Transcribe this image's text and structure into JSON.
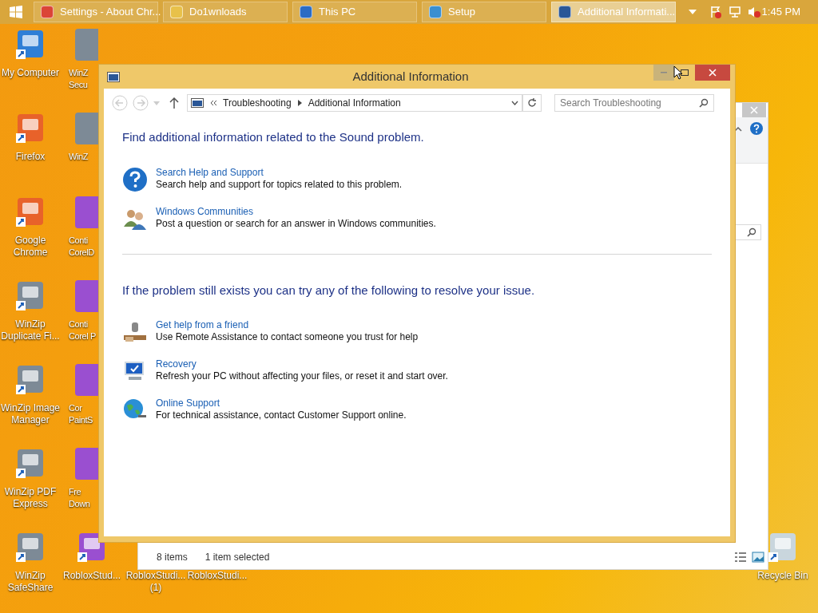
{
  "taskbar": {
    "buttons": [
      {
        "label": "Settings - About Chr...",
        "selected": false,
        "kind": "browser"
      },
      {
        "label": "Do1wnloads",
        "selected": false,
        "kind": "folder"
      },
      {
        "label": "This PC",
        "selected": false,
        "kind": "computer"
      },
      {
        "label": "Setup",
        "selected": false,
        "kind": "installer"
      },
      {
        "label": "Additional Informati...",
        "selected": true,
        "kind": "window"
      }
    ],
    "time": "1:45 PM"
  },
  "desktop": {
    "first_column": [
      {
        "lines": [
          "My Computer"
        ],
        "kind": "computer"
      },
      {
        "lines": [
          "Firefox"
        ],
        "kind": "browser"
      },
      {
        "lines": [
          "Google",
          "Chrome"
        ],
        "kind": "browser"
      },
      {
        "lines": [
          "WinZip",
          "Duplicate Fi..."
        ],
        "kind": "archive"
      },
      {
        "lines": [
          "WinZip Image",
          "Manager"
        ],
        "kind": "archive"
      },
      {
        "lines": [
          "WinZip PDF",
          "Express"
        ],
        "kind": "archive"
      },
      {
        "lines": [
          "WinZip",
          "SafeShare"
        ],
        "kind": "archive"
      }
    ],
    "second_column": [
      {
        "lines": [
          "WinZ",
          "Secu"
        ],
        "kind": "archive"
      },
      {
        "lines": [
          "WinZ"
        ],
        "kind": "archive"
      },
      {
        "lines": [
          "Conti",
          "CorelD"
        ],
        "kind": "app"
      },
      {
        "lines": [
          "Conti",
          "Corel P"
        ],
        "kind": "app"
      },
      {
        "lines": [
          "Cor",
          "PaintS"
        ],
        "kind": "app"
      },
      {
        "lines": [
          "Fre",
          "Down"
        ],
        "kind": "app"
      },
      {
        "lines": [
          "RobloxStud..."
        ],
        "kind": "app"
      }
    ],
    "bottom_row": [
      {
        "lines": [
          "RobloxStudi...",
          "(1)"
        ]
      },
      {
        "lines": [
          "RobloxStudi..."
        ]
      }
    ],
    "corner": [
      {
        "lines": [
          "Recycle Bin"
        ],
        "kind": "bin"
      }
    ]
  },
  "background_window": {
    "status_items": [
      "8 items",
      "1 item selected"
    ]
  },
  "dialog": {
    "title": "Additional Information",
    "breadcrumb": [
      "Troubleshooting",
      "Additional Information"
    ],
    "search": {
      "placeholder": "Search Troubleshooting"
    },
    "sections": [
      {
        "heading": "Find additional information related to the Sound problem.",
        "items": [
          {
            "kind": "help",
            "link": "Search Help and Support",
            "description": "Search help and support for topics related to this problem."
          },
          {
            "kind": "people",
            "link": "Windows Communities",
            "description": "Post a question or search for an answer in Windows communities."
          }
        ]
      },
      {
        "heading": "If the problem still exists you can try any of the following to resolve your issue.",
        "items": [
          {
            "kind": "remote",
            "link": "Get help from a friend",
            "description": "Use Remote Assistance to contact someone you trust for help"
          },
          {
            "kind": "recovery",
            "link": "Recovery",
            "description": "Refresh your PC without affecting your files, or reset it and start over."
          },
          {
            "kind": "globe",
            "link": "Online Support",
            "description": "For technical assistance, contact Customer Support online."
          }
        ]
      }
    ]
  }
}
